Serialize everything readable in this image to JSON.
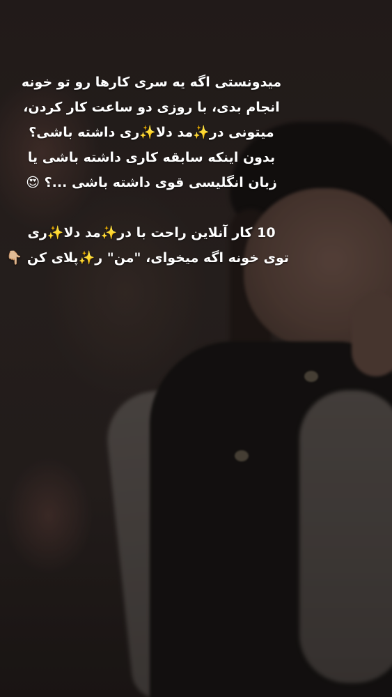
{
  "story": {
    "caption_lines": [
      "میدونستی اگه یه سری کارها رو تو خونه",
      "انجام بدی، با روزی دو ساعت کار کردن،",
      "میتونی در✨مد دلا✨ری داشته باشی؟",
      "بدون اینکه سابقه کاری داشته باشی یا",
      "زبان انگلیسی قوی داشته باشی ...؟ 😍"
    ],
    "caption_lines_2": [
      "10 کار آنلاین راحت با در✨مد دلا✨ری",
      "توی خونه اگه میخوای، \"من\" ر✨پلای کن 👇🏼"
    ]
  }
}
